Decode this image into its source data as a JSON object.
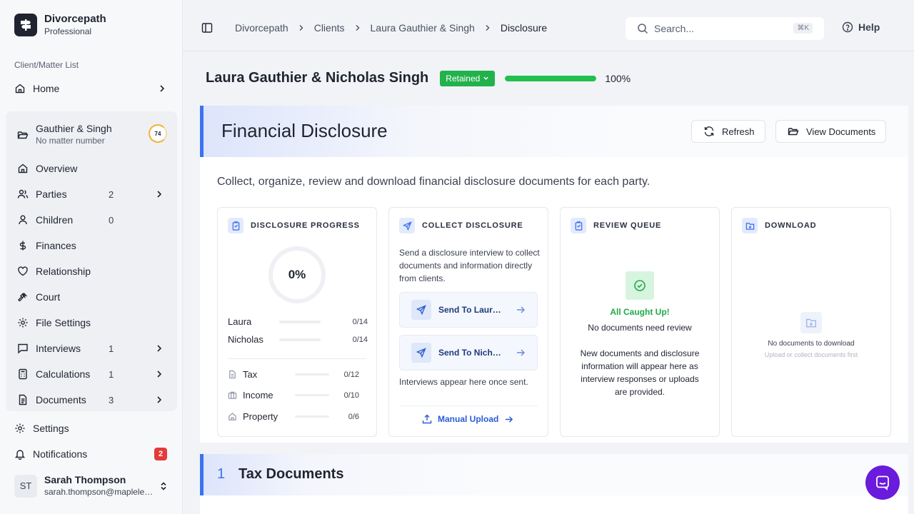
{
  "brand": {
    "name": "Divorcepath",
    "tier": "Professional"
  },
  "sidebar": {
    "section_label": "Client/Matter List",
    "home": "Home",
    "matter": {
      "name": "Gauthier & Singh",
      "number": "No matter number",
      "score": "74"
    },
    "items": [
      {
        "label": "Overview",
        "count": ""
      },
      {
        "label": "Parties",
        "count": "2"
      },
      {
        "label": "Children",
        "count": "0"
      },
      {
        "label": "Finances",
        "count": ""
      },
      {
        "label": "Relationship",
        "count": ""
      },
      {
        "label": "Court",
        "count": ""
      },
      {
        "label": "File Settings",
        "count": ""
      },
      {
        "label": "Interviews",
        "count": "1"
      },
      {
        "label": "Calculations",
        "count": "1"
      },
      {
        "label": "Documents",
        "count": "3"
      }
    ],
    "settings": "Settings",
    "notifications": "Notifications",
    "notifications_count": "2",
    "user": {
      "initials": "ST",
      "name": "Sarah Thompson",
      "email": "sarah.thompson@mapleleaflaw.ca"
    }
  },
  "header": {
    "breadcrumbs": [
      "Divorcepath",
      "Clients",
      "Laura Gauthier & Singh",
      "Disclosure"
    ],
    "search_placeholder": "Search...",
    "search_shortcut": "⌘K",
    "help": "Help"
  },
  "client": {
    "name": "Laura Gauthier & Nicholas Singh",
    "status": "Retained",
    "progress": 100,
    "progress_label": "100%"
  },
  "disclosure": {
    "title": "Financial Disclosure",
    "refresh": "Refresh",
    "view_documents": "View Documents",
    "description": "Collect, organize, review and download financial disclosure documents for each party.",
    "progress_card": {
      "title": "DISCLOSURE PROGRESS",
      "percent": "0%",
      "parties": [
        {
          "name": "Laura",
          "frac": "0/14"
        },
        {
          "name": "Nicholas",
          "frac": "0/14"
        }
      ],
      "categories": [
        {
          "name": "Tax",
          "frac": "0/12"
        },
        {
          "name": "Income",
          "frac": "0/10"
        },
        {
          "name": "Property",
          "frac": "0/6"
        }
      ]
    },
    "collect_card": {
      "title": "COLLECT DISCLOSURE",
      "text": "Send a disclosure interview to collect documents and information directly from clients.",
      "send_laura": "Send To Laura Gauthier",
      "send_nicholas": "Send To Nicholas Singh",
      "after": "Interviews appear here once sent.",
      "manual": "Manual Upload"
    },
    "review_card": {
      "title": "REVIEW QUEUE",
      "status": "All Caught Up!",
      "status_sub": "No documents need review",
      "note": "New documents and disclosure information will appear here as interview responses or uploads are provided."
    },
    "download_card": {
      "title": "DOWNLOAD",
      "empty": "No documents to download",
      "empty_sub": "Upload or collect documents first"
    }
  },
  "tax_section": {
    "number": "1",
    "title": "Tax Documents"
  }
}
